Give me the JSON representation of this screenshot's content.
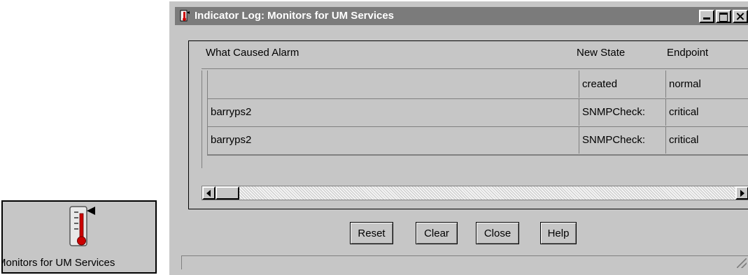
{
  "desktop_icon": {
    "label": "Monitors for UM Services",
    "icon": "thermometer-icon"
  },
  "window": {
    "title": "Indicator Log: Monitors for UM Services",
    "title_icon": "thermometer-icon",
    "controls": [
      "minimize-icon",
      "maximize-icon",
      "close-icon"
    ]
  },
  "table": {
    "columns": [
      "What Caused Alarm",
      "New State",
      "Endpoint"
    ],
    "rows": [
      [
        "",
        "created",
        "normal"
      ],
      [
        "barryps2",
        "SNMPCheck:",
        "critical"
      ],
      [
        "barryps2",
        "SNMPCheck:",
        "critical"
      ]
    ]
  },
  "buttons": {
    "reset": "Reset",
    "clear": "Clear",
    "close": "Close",
    "help": "Help"
  },
  "colors": {
    "face": "#c6c6c6",
    "titlebar": "#7b7b7b",
    "thermometer_red": "#cc0000"
  }
}
